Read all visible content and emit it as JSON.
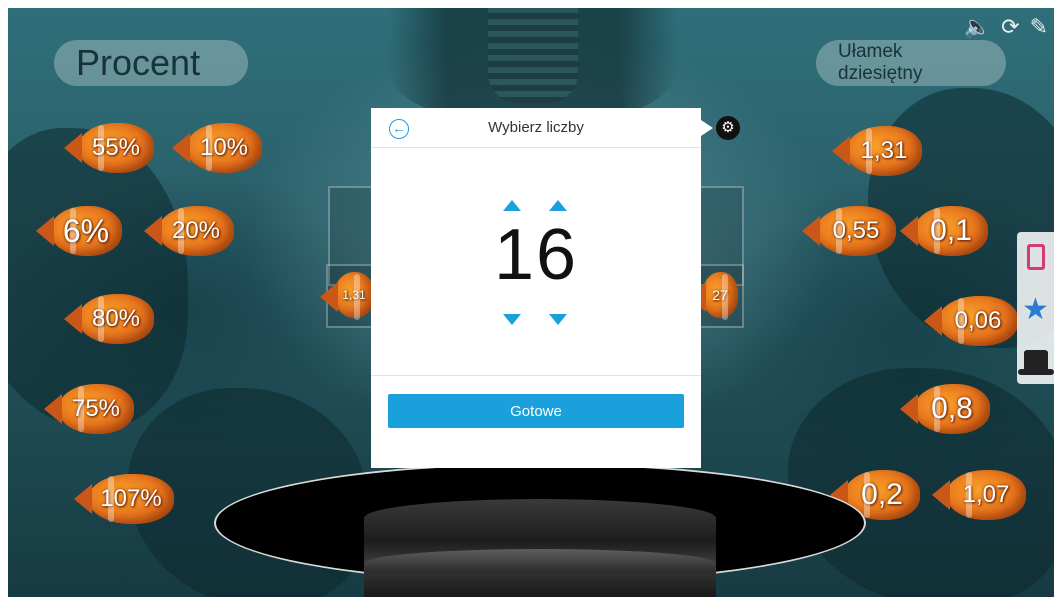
{
  "labels": {
    "left": "Procent",
    "right": "Ułamek dziesiętny"
  },
  "percent_fish": [
    "55%",
    "10%",
    "6%",
    "20%",
    "80%",
    "75%",
    "107%"
  ],
  "decimal_fish": [
    "1,31",
    "0,55",
    "0,1",
    "0,06",
    "0,8",
    "0,2",
    "1,07"
  ],
  "slot_partial": {
    "left": "1,31",
    "right": "27"
  },
  "modal": {
    "title": "Wybierz liczby",
    "value": "16",
    "done_label": "Gotowe"
  },
  "icons": {
    "back": "arrow-left-circle-icon",
    "settings": "gear-icon",
    "sound": "speaker-icon",
    "refresh": "refresh-icon",
    "edit": "pencil-icon",
    "card": "card-icon",
    "star": "star-icon",
    "hat": "magic-hat-icon"
  },
  "colors": {
    "accent": "#1aa0dc",
    "fish": "#e8731c",
    "pink": "#d33c73",
    "star": "#2a7bd1"
  }
}
